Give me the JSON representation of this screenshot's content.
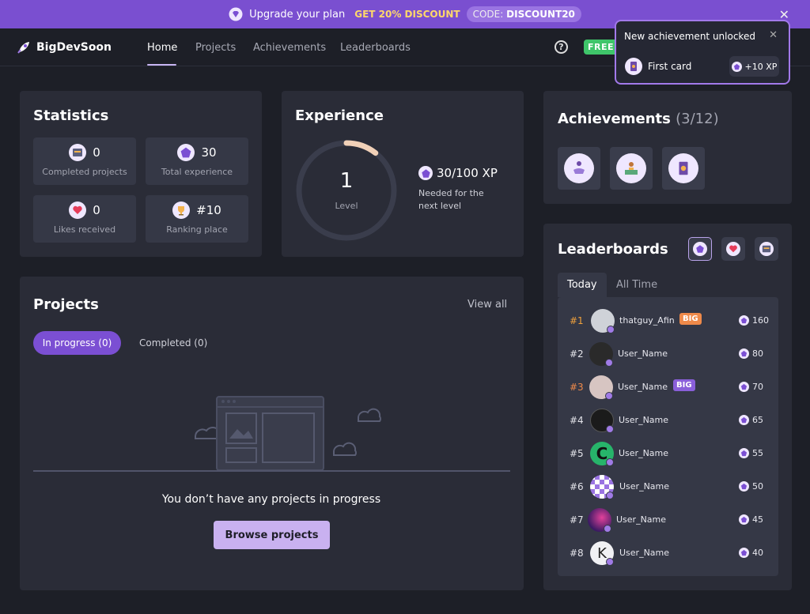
{
  "banner": {
    "text": "Upgrade your plan",
    "discount": "GET 20% DISCOUNT",
    "code_prefix": "CODE:",
    "code": "DISCOUNT20"
  },
  "nav": {
    "logo": "BigDevSoon",
    "links": [
      "Home",
      "Projects",
      "Achievements",
      "Leaderboards"
    ],
    "free_badge": "FREE",
    "help": "?"
  },
  "toast": {
    "title": "New achievement unlocked",
    "item": "First card",
    "xp": "+10 XP"
  },
  "statistics": {
    "title": "Statistics",
    "items": [
      {
        "value": "0",
        "label": "Completed projects"
      },
      {
        "value": "30",
        "label": "Total experience"
      },
      {
        "value": "0",
        "label": "Likes received"
      },
      {
        "value": "#10",
        "label": "Ranking place"
      }
    ]
  },
  "experience": {
    "title": "Experience",
    "level": "1",
    "level_label": "Level",
    "xp": "30/100 XP",
    "progress": 0.3,
    "sub": "Needed for the next level"
  },
  "achievements": {
    "title": "Achievements",
    "count": "(3/12)"
  },
  "leaderboards": {
    "title": "Leaderboards",
    "tabs": [
      "Today",
      "All Time"
    ],
    "rows": [
      {
        "rank": "#1",
        "name": "thatguy_Afin",
        "badge": "BIG",
        "points": "160"
      },
      {
        "rank": "#2",
        "name": "User_Name",
        "badge": "",
        "points": "80"
      },
      {
        "rank": "#3",
        "name": "User_Name",
        "badge": "BIG",
        "points": "70"
      },
      {
        "rank": "#4",
        "name": "User_Name",
        "badge": "",
        "points": "65"
      },
      {
        "rank": "#5",
        "name": "User_Name",
        "badge": "",
        "points": "55"
      },
      {
        "rank": "#6",
        "name": "User_Name",
        "badge": "",
        "points": "50"
      },
      {
        "rank": "#7",
        "name": "User_Name",
        "badge": "",
        "points": "45"
      },
      {
        "rank": "#8",
        "name": "User_Name",
        "badge": "",
        "points": "40"
      }
    ]
  },
  "projects": {
    "title": "Projects",
    "view_all": "View all",
    "tab_active": "In progress (0)",
    "tab_other": "Completed (0)",
    "empty": "You don’t have any projects in progress",
    "browse": "Browse projects"
  }
}
